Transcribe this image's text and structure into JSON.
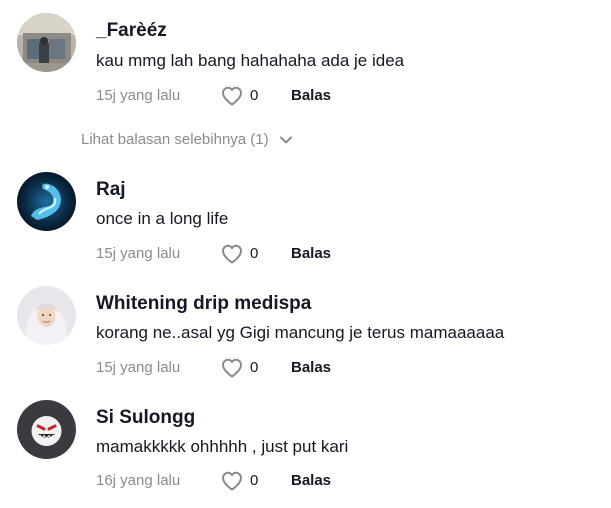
{
  "comments": [
    {
      "username": "_Farèéz",
      "text": "kau mmg lah bang hahahaha ada je idea",
      "time": "15j yang lalu",
      "likes": "0",
      "reply_label": "Balas",
      "avatar": "photo-storefront"
    },
    {
      "username": "Raj",
      "text": "once in a long life",
      "time": "15j yang lalu",
      "likes": "0",
      "reply_label": "Balas",
      "avatar": "dragon-art"
    },
    {
      "username": "Whitening drip medispa",
      "text": "korang ne..asal yg Gigi mancung je terus mamaaaaaa",
      "time": "15j yang lalu",
      "likes": "0",
      "reply_label": "Balas",
      "avatar": "woman-hijab"
    },
    {
      "username": "Si Sulongg",
      "text": "mamakkkkk ohhhhh , just put kari",
      "time": "16j yang lalu",
      "likes": "0",
      "reply_label": "Balas",
      "avatar": "grinning-face"
    }
  ],
  "view_more_replies": "Lihat balasan selebihnya (1)",
  "icons": {
    "like": "heart-outline-icon",
    "expand": "chevron-down-icon"
  },
  "colors": {
    "text": "#161823",
    "muted": "#8a8b91",
    "background": "#ffffff"
  }
}
